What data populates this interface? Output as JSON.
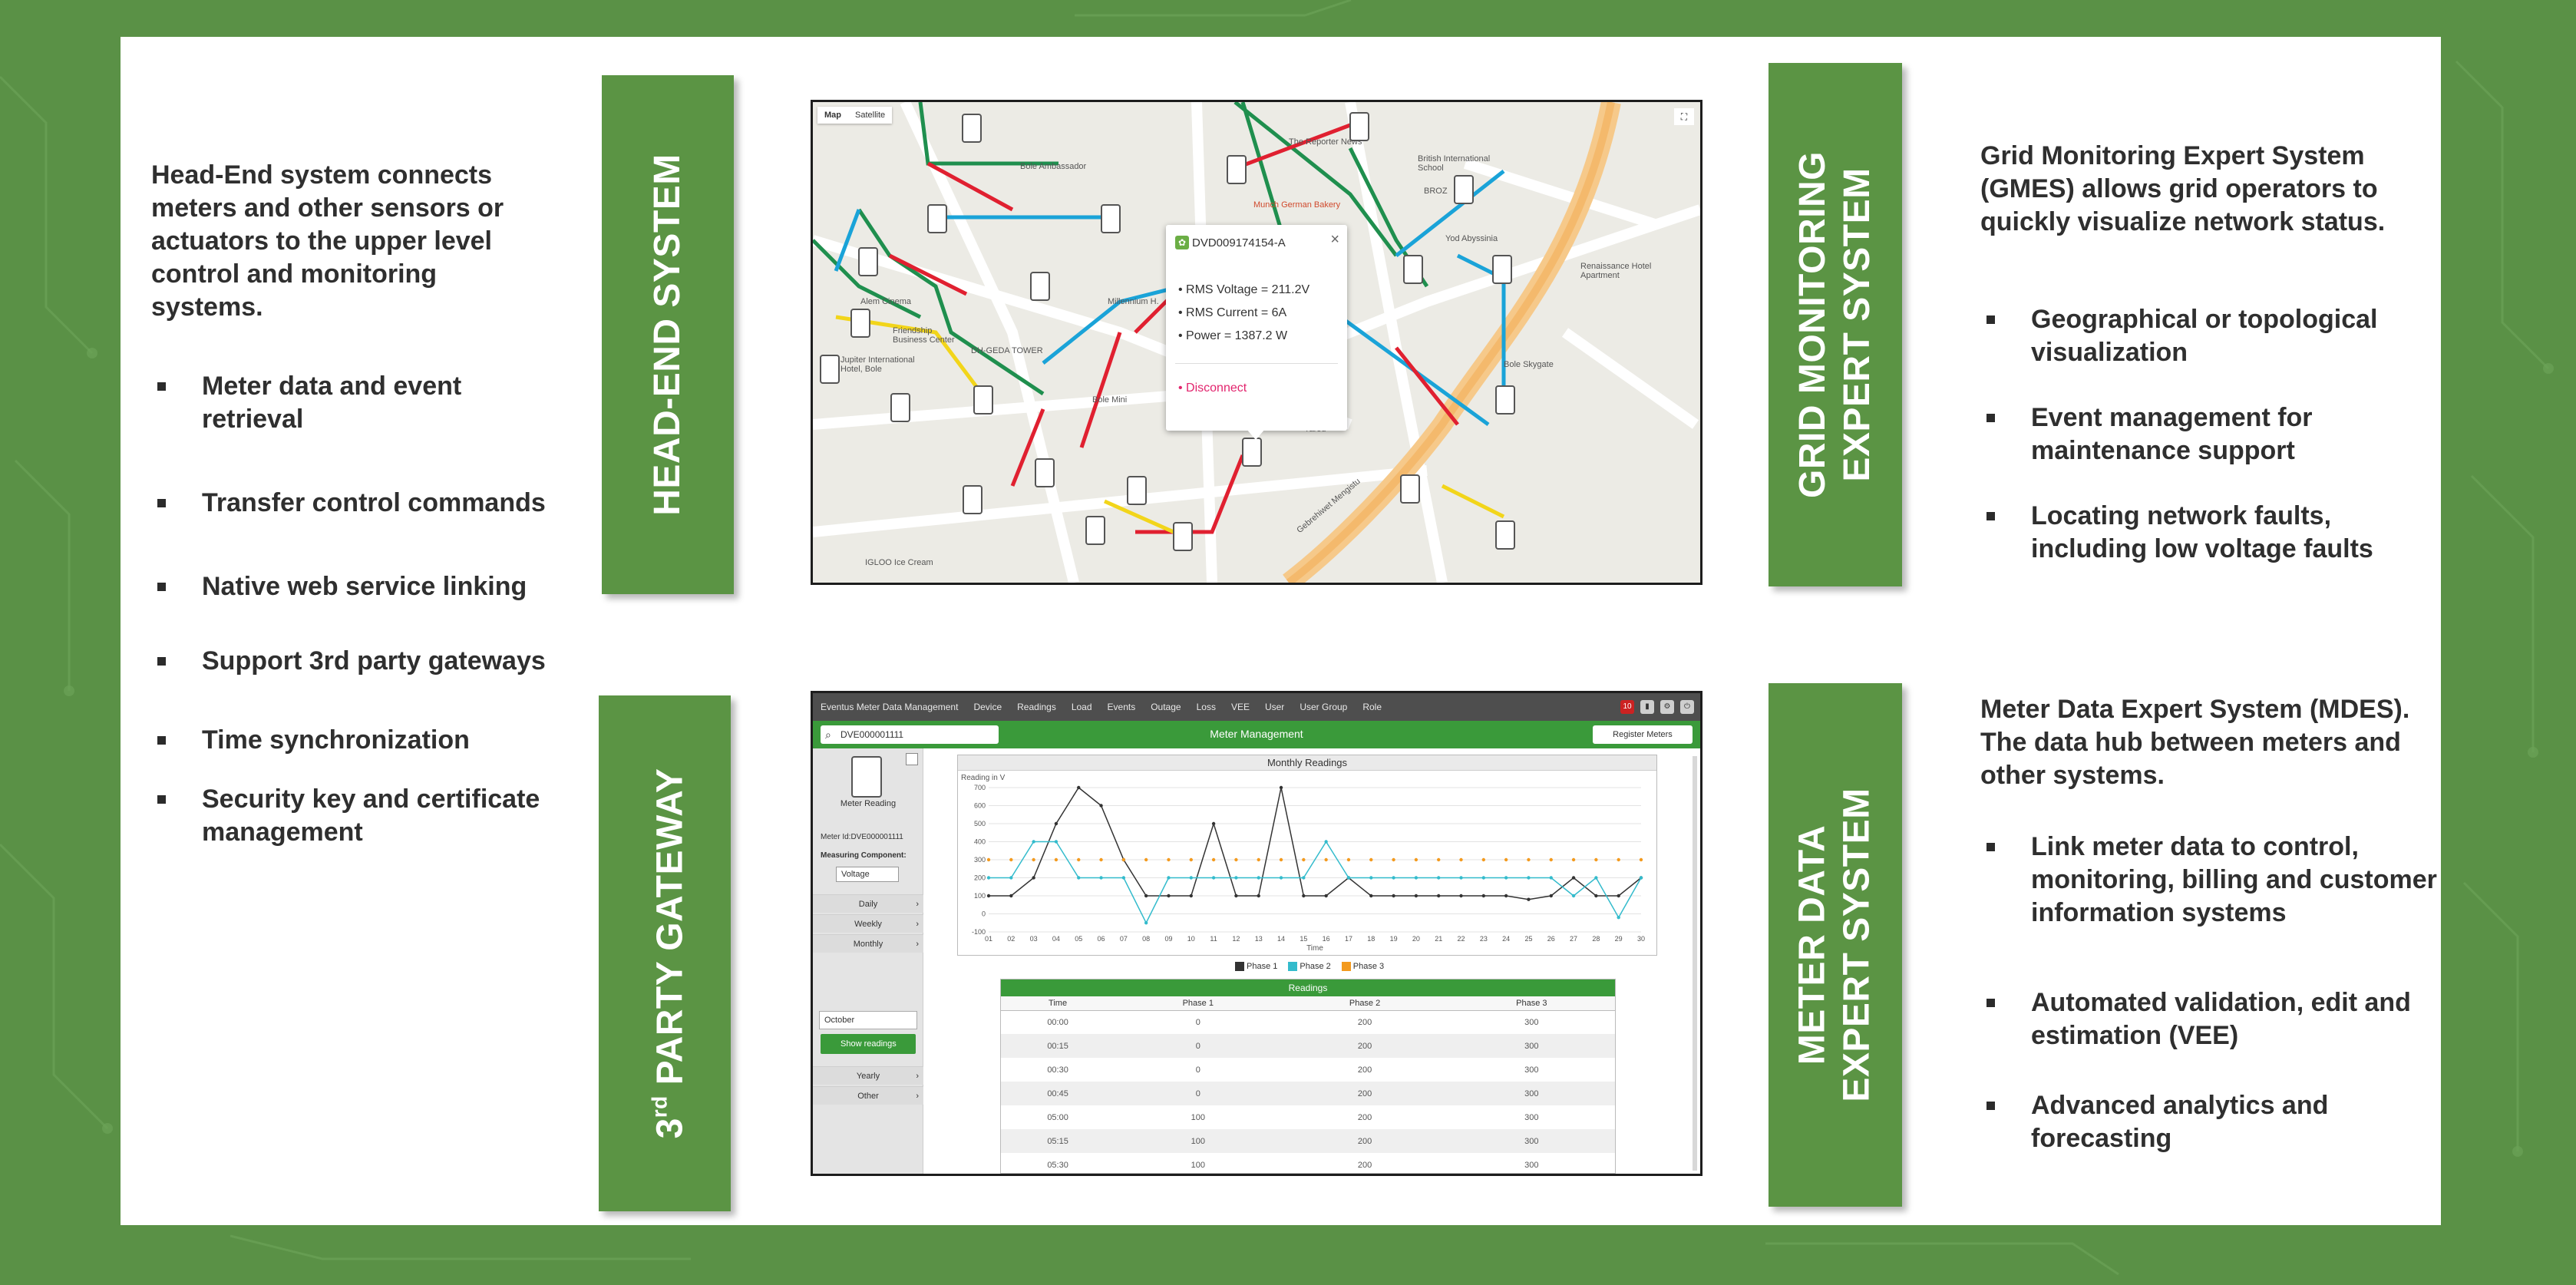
{
  "head_end": {
    "bar_label": "HEAD-END SYSTEM",
    "intro": "Head-End system connects meters and other sensors or actuators to the upper level control and monitoring systems.",
    "bullets": [
      "Meter data and event retrieval",
      "Transfer control commands",
      "Native web service linking",
      "Support 3rd party gateways",
      "Time synchronization",
      "Security key and certificate management"
    ]
  },
  "gateway": {
    "bar_num": "3",
    "bar_sup": "rd",
    "bar_rest": " PARTY GATEWAY"
  },
  "gmes": {
    "bar_line1": "GRID MONITORING",
    "bar_line2": "EXPERT SYSTEM",
    "intro": "Grid Monitoring Expert System (GMES) allows grid operators to quickly visualize network status.",
    "bullets": [
      "Geographical or topological visualization",
      "Event management for maintenance support",
      "Locating network faults, including low voltage faults"
    ]
  },
  "mdes": {
    "bar_line1": "METER DATA",
    "bar_line2": "EXPERT SYSTEM",
    "intro": "Meter Data Expert System (MDES). The data hub between meters and other systems.",
    "bullets": [
      "Link meter data to control, monitoring, billing and customer information systems",
      "Automated validation, edit and estimation (VEE)",
      "Advanced analytics and forecasting"
    ]
  },
  "map": {
    "tabs": [
      "Map",
      "Satellite"
    ],
    "labels": {
      "bole_ambassador": "Bole Ambassador",
      "reporter": "The Reporter News",
      "british": "British International School",
      "munch": "Munch German Bakery",
      "broz": "BROZ",
      "yod": "Yod Abyssinia",
      "renaissance": "Renaissance Hotel Apartment",
      "alem": "Alem Cinema",
      "millennium": "Millennium H.",
      "friendship": "Friendship Business Center",
      "dh_geda": "DH-GEDA TOWER",
      "jupiter": "Jupiter International Hotel, Bole",
      "bole_mini": "Bole Mini",
      "bole_skygate": "Bole Skygate",
      "igloo": "IGLOO Ice Cream",
      "yared": "Yared",
      "gebrehiwet": "Gebrehiwet Mengistu"
    },
    "popup": {
      "meter_id": "DVD009174154-A",
      "close": "×",
      "rms_voltage_label": "RMS Voltage =",
      "rms_voltage": "211.2V",
      "rms_current_label": "RMS Current =",
      "rms_current": "6A",
      "power_label": "Power =",
      "power": "1387.2 W",
      "disconnect": "Disconnect"
    }
  },
  "dashboard": {
    "nav": [
      "Eventus Meter Data Management",
      "Device",
      "Readings",
      "Load",
      "Events",
      "Outage",
      "Loss",
      "VEE",
      "User",
      "User Group",
      "Role"
    ],
    "alert_count": "10",
    "search_value": "DVE000001111",
    "page_title": "Meter Management",
    "register_btn": "Register Meters",
    "meter_label": "Meter Reading",
    "meter_id_line": "Meter Id:DVE000001111",
    "measuring_label": "Measuring Component:",
    "measuring_value": "Voltage",
    "side_nav": [
      "Daily",
      "Weekly",
      "Monthly"
    ],
    "date_field": "October",
    "show_btn": "Show readings",
    "side_nav2": [
      "Yearly",
      "Other"
    ],
    "chart_title": "Monthly Readings",
    "legend": [
      "Phase 1",
      "Phase 2",
      "Phase 3"
    ],
    "table_title": "Readings",
    "table_headers": [
      "Time",
      "Phase 1",
      "Phase 2",
      "Phase 3"
    ],
    "table_rows": [
      [
        "00:00",
        "0",
        "200",
        "300"
      ],
      [
        "00:15",
        "0",
        "200",
        "300"
      ],
      [
        "00:30",
        "0",
        "200",
        "300"
      ],
      [
        "00:45",
        "0",
        "200",
        "300"
      ],
      [
        "05:00",
        "100",
        "200",
        "300"
      ],
      [
        "05:15",
        "100",
        "200",
        "300"
      ],
      [
        "05:30",
        "100",
        "200",
        "300"
      ]
    ]
  },
  "chart_data": {
    "type": "line",
    "title": "Monthly Readings",
    "ylabel": "Reading in V",
    "xlabel": "Time",
    "x": [
      "01",
      "02",
      "03",
      "04",
      "05",
      "06",
      "07",
      "08",
      "09",
      "10",
      "11",
      "12",
      "13",
      "14",
      "15",
      "16",
      "17",
      "18",
      "19",
      "20",
      "21",
      "22",
      "23",
      "24",
      "25",
      "26",
      "27",
      "28",
      "29",
      "30"
    ],
    "ylim": [
      -100,
      700
    ],
    "series": [
      {
        "name": "Phase 1",
        "color": "#333333",
        "values": [
          100,
          100,
          200,
          500,
          700,
          600,
          300,
          100,
          100,
          100,
          500,
          100,
          100,
          700,
          100,
          100,
          200,
          100,
          100,
          100,
          100,
          100,
          100,
          100,
          80,
          100,
          200,
          100,
          100,
          200
        ]
      },
      {
        "name": "Phase 2",
        "color": "#33bbcc",
        "values": [
          200,
          200,
          400,
          400,
          200,
          200,
          200,
          -50,
          200,
          200,
          200,
          200,
          200,
          200,
          200,
          400,
          200,
          200,
          200,
          200,
          200,
          200,
          200,
          200,
          200,
          200,
          100,
          200,
          -20,
          200
        ]
      },
      {
        "name": "Phase 3",
        "color": "#f39a1e",
        "values": [
          300,
          300,
          300,
          300,
          300,
          300,
          300,
          300,
          300,
          300,
          300,
          300,
          300,
          300,
          300,
          300,
          300,
          300,
          300,
          300,
          300,
          300,
          300,
          300,
          300,
          300,
          300,
          300,
          300,
          300
        ]
      }
    ],
    "colors": {
      "brand_green": "#5b9444",
      "bg_green": "#5a9146"
    }
  }
}
